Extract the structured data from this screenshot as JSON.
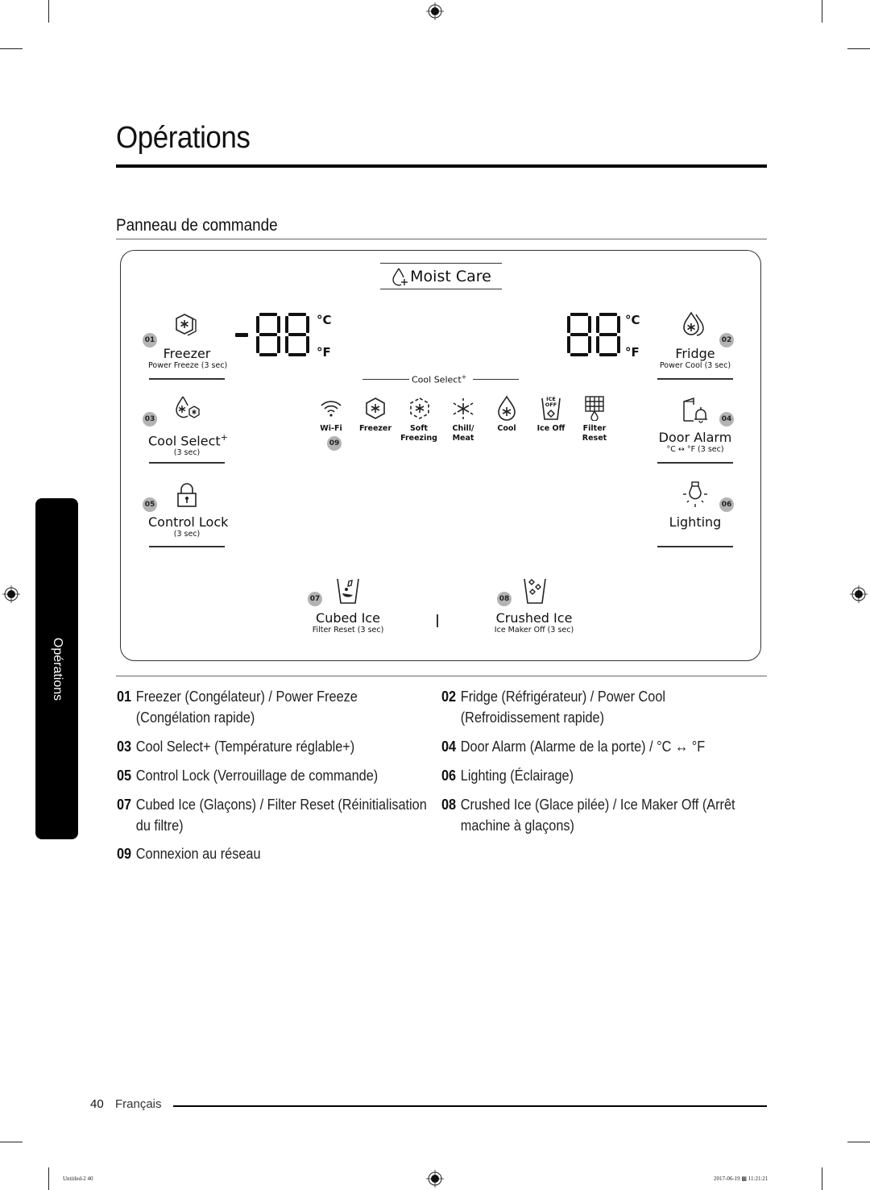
{
  "page": {
    "title": "Opérations",
    "section_title": "Panneau de commande",
    "side_tab": "Opérations",
    "footer": {
      "page_number": "40",
      "language": "Français"
    },
    "print_info": {
      "left": "Untitled-2   40",
      "right": "2017-06-19   ▩ 11:21:21"
    }
  },
  "panel": {
    "moist_care": {
      "label": "Moist Care",
      "icon": "water-drop-plus-icon"
    },
    "freezer_display": {
      "digits": "-88",
      "unit_c": "°C",
      "unit_f": "°F"
    },
    "fridge_display": {
      "digits": "88",
      "unit_c": "°C",
      "unit_f": "°F"
    },
    "cool_select_line": "Cool Select",
    "cool_select_sup": "+",
    "buttons": [
      {
        "num": "01",
        "label": "Freezer",
        "sub": "Power Freeze (3 sec)",
        "icon": "freezer-hexagon-icon"
      },
      {
        "num": "02",
        "label": "Fridge",
        "sub": "Power Cool (3 sec)",
        "icon": "fridge-drops-icon"
      },
      {
        "num": "03",
        "label": "Cool Select",
        "label_sup": "+",
        "sub": "(3 sec)",
        "icon": "cool-select-icon"
      },
      {
        "num": "04",
        "label": "Door Alarm",
        "sub": "°C ↔ °F (3 sec)",
        "icon": "door-alarm-icon"
      },
      {
        "num": "05",
        "label": "Control Lock",
        "sub": "(3 sec)",
        "icon": "lock-icon"
      },
      {
        "num": "06",
        "label": "Lighting",
        "sub": "",
        "icon": "light-bulb-icon"
      },
      {
        "num": "07",
        "label": "Cubed Ice",
        "sub": "Filter Reset (3 sec)",
        "icon": "cubed-ice-icon"
      },
      {
        "num": "08",
        "label": "Crushed Ice",
        "sub": "Ice Maker Off (3 sec)",
        "icon": "crushed-ice-icon"
      }
    ],
    "indicators": [
      {
        "label1": "Wi-Fi",
        "label2": "",
        "icon": "wifi-icon"
      },
      {
        "label1": "Freezer",
        "label2": "",
        "icon": "freezer-indicator-icon"
      },
      {
        "label1": "Soft",
        "label2": "Freezing",
        "icon": "soft-freezing-icon"
      },
      {
        "label1": "Chill/",
        "label2": "Meat",
        "icon": "chill-meat-icon"
      },
      {
        "label1": "Cool",
        "label2": "",
        "icon": "cool-drop-icon"
      },
      {
        "label1": "Ice Off",
        "label2": "",
        "icon": "ice-off-icon",
        "icon_text1": "ICE",
        "icon_text2": "OFF"
      },
      {
        "label1": "Filter",
        "label2": "Reset",
        "icon": "filter-reset-icon"
      }
    ],
    "wifi_badge": "09"
  },
  "descriptions": [
    {
      "num": "01",
      "line1": "Freezer (Congélateur) / Power Freeze",
      "line2": "(Congélation rapide)"
    },
    {
      "num": "02",
      "line1": "Fridge (Réfrigérateur) / Power Cool",
      "line2": "(Refroidissement rapide)"
    },
    {
      "num": "03",
      "line1": "Cool Select+ (Température réglable+)",
      "line2": ""
    },
    {
      "num": "04",
      "line1": "Door Alarm (Alarme de la porte) / °C ↔ °F",
      "line2": ""
    },
    {
      "num": "05",
      "line1": "Control Lock (Verrouillage de commande)",
      "line2": ""
    },
    {
      "num": "06",
      "line1": "Lighting (Éclairage)",
      "line2": ""
    },
    {
      "num": "07",
      "line1": "Cubed Ice (Glaçons) / Filter Reset (Réinitialisation",
      "line2": "du filtre)"
    },
    {
      "num": "08",
      "line1": "Crushed Ice (Glace pilée) / Ice Maker Off (Arrêt",
      "line2": "machine à glaçons)"
    },
    {
      "num": "09",
      "line1": "Connexion au réseau",
      "line2": ""
    }
  ]
}
